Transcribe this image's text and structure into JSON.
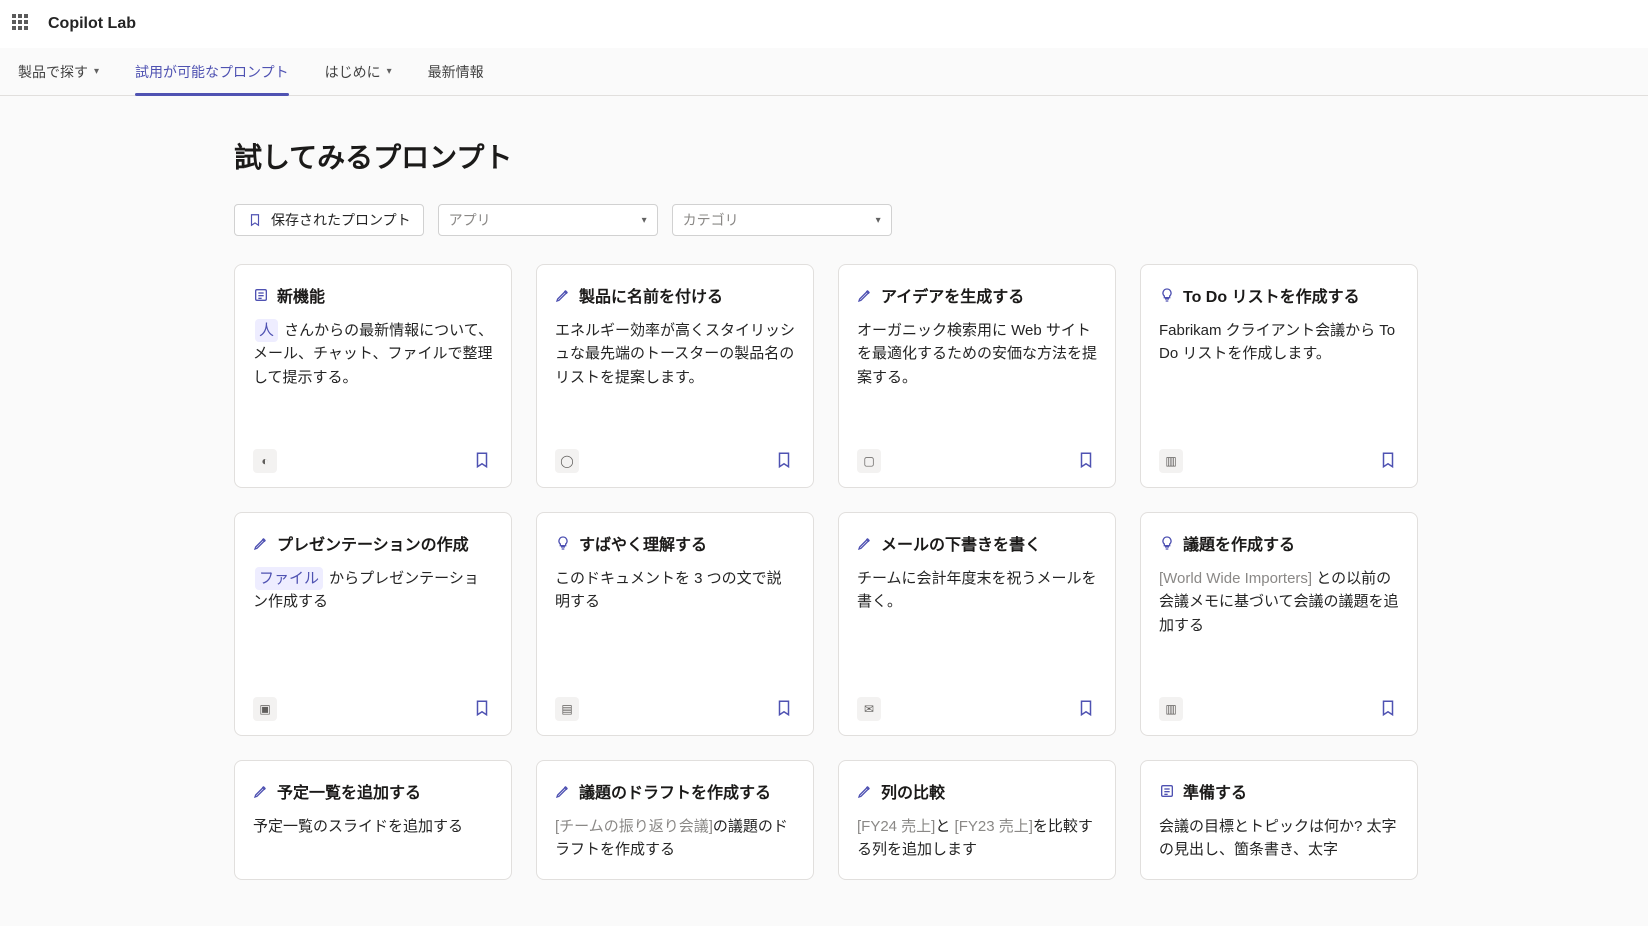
{
  "brand": "Copilot Lab",
  "tabs": [
    {
      "label": "製品で探す",
      "hasChevron": true,
      "active": false
    },
    {
      "label": "試用が可能なプロンプト",
      "hasChevron": false,
      "active": true
    },
    {
      "label": "はじめに",
      "hasChevron": true,
      "active": false
    },
    {
      "label": "最新情報",
      "hasChevron": false,
      "active": false
    }
  ],
  "pageTitle": "試してみるプロンプト",
  "filters": {
    "saved": "保存されたプロンプト",
    "appPlaceholder": "アプリ",
    "categoryPlaceholder": "カテゴリ"
  },
  "cards": [
    {
      "icon": "list",
      "title": "新機能",
      "bodyPre": "",
      "chip": "人",
      "bodyPost": " さんからの最新情報について、メール、チャット、ファイルで整理して提示する。",
      "app": "copilot"
    },
    {
      "icon": "pen",
      "title": "製品に名前を付ける",
      "bodyPre": "エネルギー効率が高くスタイリッシュな最先端のトースターの製品名のリストを提案します。",
      "chip": "",
      "bodyPost": "",
      "app": "loop"
    },
    {
      "icon": "pen",
      "title": "アイデアを生成する",
      "bodyPre": "オーガニック検索用に Web サイトを最適化するための安価な方法を提案する。",
      "chip": "",
      "bodyPost": "",
      "app": "whiteboard"
    },
    {
      "icon": "bulb",
      "title": "To Do リストを作成する",
      "bodyPre": "Fabrikam クライアント会議から To Do リストを作成します。",
      "chip": "",
      "bodyPost": "",
      "app": "onenote"
    },
    {
      "icon": "pen",
      "title": "プレゼンテーションの作成",
      "bodyPre": "",
      "chip": "ファイル",
      "bodyPost": " からプレゼンテーション作成する",
      "app": "powerpoint"
    },
    {
      "icon": "bulb",
      "title": "すばやく理解する",
      "bodyPre": "このドキュメントを 3 つの文で説明する",
      "chip": "",
      "bodyPost": "",
      "app": "word"
    },
    {
      "icon": "pen",
      "title": "メールの下書きを書く",
      "bodyPre": "チームに会計年度末を祝うメールを書く。",
      "chip": "",
      "bodyPost": "",
      "app": "outlook"
    },
    {
      "icon": "bulb",
      "title": "議題を作成する",
      "bodyPre": "",
      "bracket": "[World Wide Importers]",
      "bodyPost": " との以前の会議メモに基づいて会議の議題を追加する",
      "app": "onenote"
    },
    {
      "icon": "pen",
      "title": "予定一覧を追加する",
      "bodyPre": "予定一覧のスライドを追加する",
      "chip": "",
      "bodyPost": "",
      "app": "",
      "short": true
    },
    {
      "icon": "pen",
      "title": "議題のドラフトを作成する",
      "bodyPre": "",
      "bracket": "[チームの振り返り会議]",
      "bodyPost": "の議題のドラフトを作成する",
      "app": "",
      "short": true
    },
    {
      "icon": "pen",
      "title": "列の比較",
      "bodyPre": "",
      "bracket": "[FY24 売上]",
      "bodyMid": "と ",
      "bracket2": "[FY23 売上]",
      "bodyPost": "を比較する列を追加します",
      "app": "",
      "short": true
    },
    {
      "icon": "list",
      "title": "準備する",
      "bodyPre": "会議の目標とトピックは何か? 太字の見出し、箇条書き、太字",
      "chip": "",
      "bodyPost": "",
      "app": "",
      "short": true
    }
  ]
}
